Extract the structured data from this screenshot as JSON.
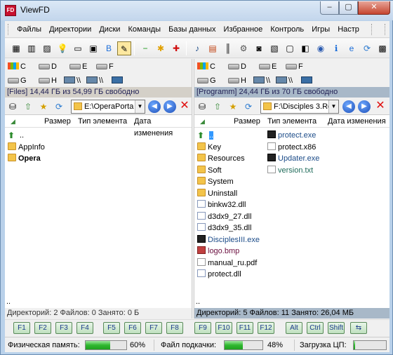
{
  "window": {
    "title": "ViewFD",
    "app_icon_text": "FD",
    "min": "–",
    "max": "▢",
    "close": "✕"
  },
  "menu": [
    "Файлы",
    "Директории",
    "Диски",
    "Команды",
    "Базы данных",
    "Избранное",
    "Контроль",
    "Игры",
    "Настр"
  ],
  "toolbar_icons": [
    "panels-icon",
    "columns-icon",
    "image-icon",
    "bulb-icon",
    "card-icon",
    "screen-icon",
    "b-icon",
    "pen-icon",
    "minus-icon",
    "star-icon",
    "plus-icon",
    "music-icon",
    "film-icon",
    "barcode-icon",
    "gear-icon",
    "camera-icon",
    "picture-icon",
    "monitor-icon",
    "wallet-icon",
    "media-icon",
    "info-icon",
    "ie-icon",
    "refresh-icon",
    "chip-icon",
    "tools-icon",
    "puzzle-icon"
  ],
  "left": {
    "drives": [
      {
        "letter": "C",
        "kind": "sys"
      },
      {
        "letter": "D",
        "kind": "hdd"
      },
      {
        "letter": "E",
        "kind": "hdd"
      },
      {
        "letter": "F",
        "kind": "hdd"
      },
      {
        "letter": "G",
        "kind": "hdd"
      },
      {
        "letter": "H",
        "kind": "hdd"
      },
      {
        "letter": "\\\\",
        "kind": "net"
      },
      {
        "letter": "\\\\",
        "kind": "net2"
      },
      {
        "letter": "",
        "kind": "mon"
      }
    ],
    "free": "[Files] 14,44 ГБ из 54,99 ГБ свободно",
    "path": "E:\\OperaPorta",
    "columns": {
      "size": "Размер",
      "type": "Тип элемента",
      "date": "Дата изменения"
    },
    "files": [
      {
        "name": "..",
        "kind": "up"
      },
      {
        "name": "AppInfo",
        "kind": "folder"
      },
      {
        "name": "Opera",
        "kind": "folder",
        "bold": true
      }
    ],
    "dots": "..",
    "status": "Директорий: 2   Файлов: 0   Занято: 0 Б"
  },
  "right": {
    "drives": [
      {
        "letter": "C",
        "kind": "sys"
      },
      {
        "letter": "D",
        "kind": "hdd"
      },
      {
        "letter": "E",
        "kind": "hdd"
      },
      {
        "letter": "F",
        "kind": "hdd"
      },
      {
        "letter": "G",
        "kind": "hdd"
      },
      {
        "letter": "H",
        "kind": "hdd"
      },
      {
        "letter": "\\\\",
        "kind": "net"
      },
      {
        "letter": "\\\\",
        "kind": "net2"
      },
      {
        "letter": "",
        "kind": "mon"
      }
    ],
    "free": "[Programm] 24,44 ГБ из 70 ГБ свободно",
    "path": "F:\\Disciples 3.Re",
    "columns": {
      "size": "Размер",
      "type": "Тип элемента",
      "date": "Дата изменения"
    },
    "files_col1": [
      {
        "name": "..",
        "kind": "up"
      },
      {
        "name": "Key",
        "kind": "folder"
      },
      {
        "name": "Resources",
        "kind": "folder"
      },
      {
        "name": "Soft",
        "kind": "folder"
      },
      {
        "name": "System",
        "kind": "folder"
      },
      {
        "name": "Uninstall",
        "kind": "folder"
      },
      {
        "name": "binkw32.dll",
        "kind": "dll"
      },
      {
        "name": "d3dx9_27.dll",
        "kind": "dll"
      },
      {
        "name": "d3dx9_35.dll",
        "kind": "dll"
      },
      {
        "name": "DisciplesIII.exe",
        "kind": "exe"
      },
      {
        "name": "logo.bmp",
        "kind": "bmp"
      },
      {
        "name": "manual_ru.pdf",
        "kind": "pdf"
      },
      {
        "name": "protect.dll",
        "kind": "dll"
      }
    ],
    "files_col2": [
      {
        "name": "protect.exe",
        "kind": "exe"
      },
      {
        "name": "protect.x86",
        "kind": "file"
      },
      {
        "name": "Updater.exe",
        "kind": "exe"
      },
      {
        "name": "version.txt",
        "kind": "txt"
      }
    ],
    "dots": "..",
    "status": "Директорий: 5   Файлов: 11   Занято: 26,04 МБ"
  },
  "fkeys": [
    "F1",
    "F2",
    "F3",
    "F4",
    "F5",
    "F6",
    "F7",
    "F8",
    "F9",
    "F10",
    "F11",
    "F12",
    "Alt",
    "Ctrl",
    "Shift",
    "⇆"
  ],
  "bottom": {
    "mem_label": "Физическая память:",
    "mem_value": "60%",
    "mem_level": 0.6,
    "swap_label": "Файл подкачки:",
    "swap_value": "48%",
    "swap_level": 0.48,
    "cpu_label": "Загрузка ЦП:",
    "cpu_level": 0.05
  }
}
